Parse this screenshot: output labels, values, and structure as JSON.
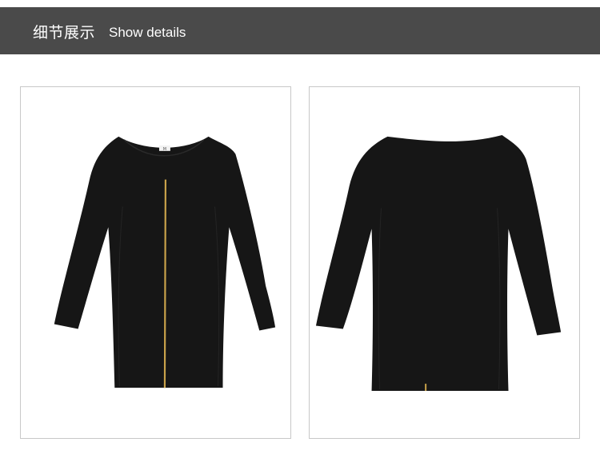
{
  "header": {
    "title_cn": "细节展示",
    "title_en": "Show details"
  },
  "colors": {
    "header_bg": "#4a4a4a",
    "header_text": "#ffffff",
    "frame_border": "#c8c8c8",
    "garment": "#161616",
    "zipper": "#c9a24a"
  },
  "photos": [
    {
      "view": "front",
      "label_tag": "M"
    },
    {
      "view": "back"
    }
  ]
}
